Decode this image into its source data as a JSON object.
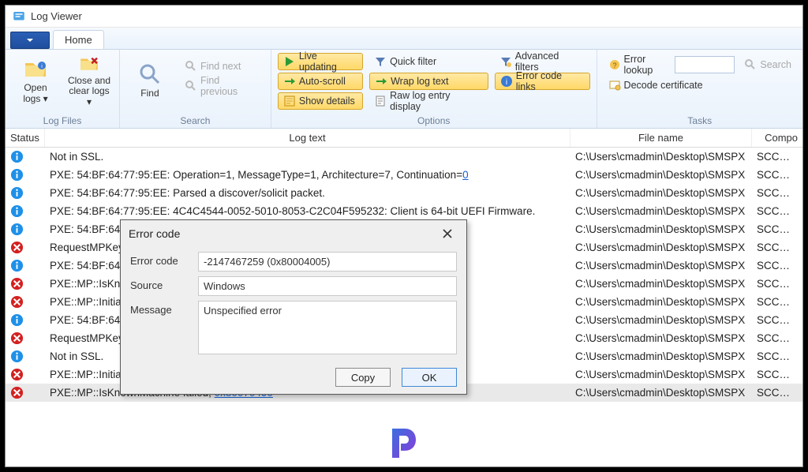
{
  "window": {
    "title": "Log Viewer"
  },
  "ribbon": {
    "home_tab": "Home",
    "groups": {
      "log_files": {
        "label": "Log Files",
        "open_logs": "Open\nlogs ▾",
        "close_clear": "Close and\nclear logs ▾"
      },
      "search": {
        "label": "Search",
        "find": "Find",
        "find_next": "Find next",
        "find_previous": "Find previous"
      },
      "options": {
        "label": "Options",
        "live_updating": "Live updating",
        "auto_scroll": "Auto-scroll",
        "show_details": "Show details",
        "quick_filter": "Quick filter",
        "wrap_log_text": "Wrap log text",
        "raw_log": "Raw log entry display",
        "advanced_filters": "Advanced filters",
        "error_code_links": "Error code links"
      },
      "tasks": {
        "label": "Tasks",
        "error_lookup": "Error lookup",
        "decode_cert": "Decode certificate",
        "search_btn": "Search"
      }
    }
  },
  "columns": {
    "status": "Status",
    "log_text": "Log text",
    "file_name": "File name",
    "component": "Compo"
  },
  "common": {
    "file": "C:\\Users\\cmadmin\\Desktop\\SMSPX",
    "component": "SCCMPXE"
  },
  "rows": [
    {
      "kind": "info",
      "text_parts": [
        {
          "t": "Not in SSL."
        }
      ]
    },
    {
      "kind": "info",
      "text_parts": [
        {
          "t": "PXE: 54:BF:64:77:95:EE: Operation=1, MessageType=1, Architecture=7, Continuation="
        },
        {
          "t": "0",
          "link": true
        }
      ]
    },
    {
      "kind": "info",
      "text_parts": [
        {
          "t": "PXE: 54:BF:64:77:95:EE: Parsed a discover/solicit packet."
        }
      ]
    },
    {
      "kind": "info",
      "text_parts": [
        {
          "t": "PXE: 54:BF:64:77:95:EE: 4C4C4544-0052-5010-8053-C2C04F595232: Client is 64-bit UEFI Firmware."
        }
      ]
    },
    {
      "kind": "info",
      "text_parts": [
        {
          "t": "PXE: 54:BF:64:77"
        }
      ]
    },
    {
      "kind": "error",
      "text_parts": [
        {
          "t": "RequestMPKeyIn"
        }
      ]
    },
    {
      "kind": "info",
      "text_parts": [
        {
          "t": "PXE: 54:BF:64:77"
        }
      ]
    },
    {
      "kind": "error",
      "text_parts": [
        {
          "t": "PXE::MP::IsKnow"
        }
      ]
    },
    {
      "kind": "error",
      "text_parts": [
        {
          "t": "PXE::MP::Initializ"
        }
      ]
    },
    {
      "kind": "info",
      "text_parts": [
        {
          "t": "PXE: 54:BF:64:77"
        }
      ]
    },
    {
      "kind": "error",
      "text_parts": [
        {
          "t": "RequestMPKeyIn"
        }
      ]
    },
    {
      "kind": "info",
      "text_parts": [
        {
          "t": "Not in SSL."
        }
      ]
    },
    {
      "kind": "error",
      "text_parts": [
        {
          "t": "PXE::MP::Initializ"
        }
      ]
    },
    {
      "kind": "error",
      "sel": true,
      "text_parts": [
        {
          "t": "PXE::MP::IsKnownMachine failed; "
        },
        {
          "t": "0x80070490",
          "link": true
        }
      ]
    }
  ],
  "dialog": {
    "title": "Error code",
    "labels": {
      "code": "Error code",
      "source": "Source",
      "message": "Message"
    },
    "values": {
      "code": "-2147467259 (0x80004005)",
      "source": "Windows",
      "message": "Unspecified error"
    },
    "buttons": {
      "copy": "Copy",
      "ok": "OK"
    }
  }
}
